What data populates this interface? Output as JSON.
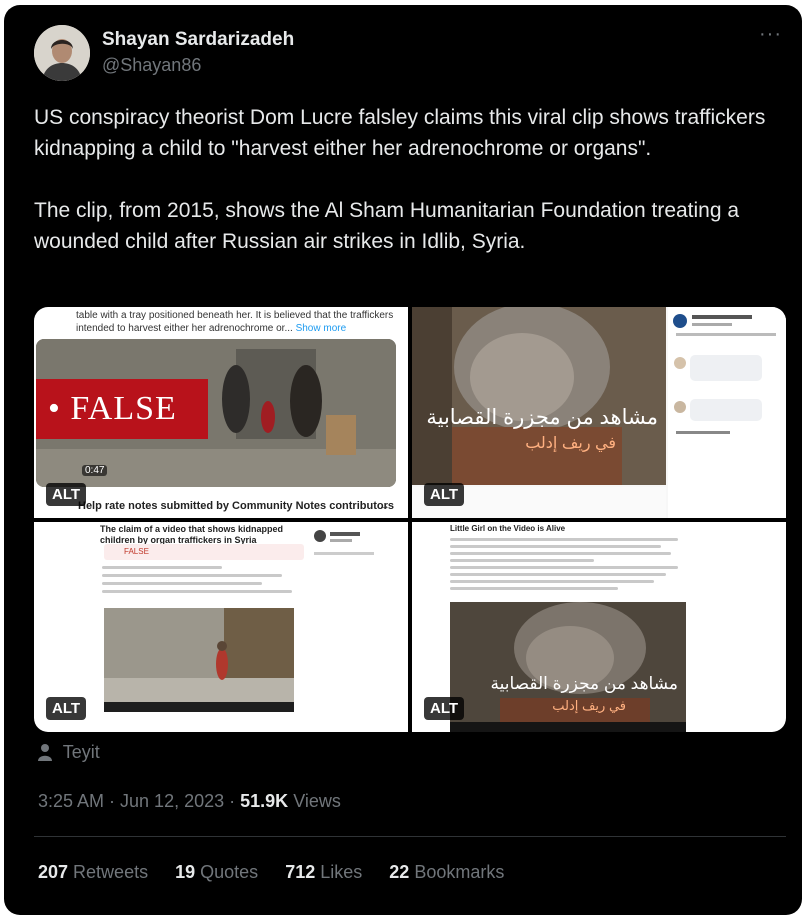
{
  "author": {
    "name": "Shayan Sardarizadeh",
    "handle": "@Shayan86"
  },
  "more_menu": "···",
  "tweet": {
    "paragraph1": "US conspiracy theorist Dom Lucre falsley claims this viral clip shows traffickers kidnapping a child to \"harvest either her adrenochrome or organs\".",
    "paragraph2": "The clip, from 2015, shows the Al Sham Humanitarian Foundation treating a wounded child after Russian air strikes in Idlib, Syria."
  },
  "media": {
    "alt_label": "ALT",
    "tile1": {
      "caption": "table with a tray positioned beneath her. It is believed that the traffickers intended to harvest either her adrenochrome or...",
      "show_more": "Show more",
      "false_label": "• FALSE",
      "duration": "0:47",
      "notes_text": "Help rate notes submitted by Community Notes contributors",
      "notes_arrow": "→"
    },
    "tile2": {
      "arabic_line1": "مشاهد من مجزرة القصابية",
      "arabic_line2": "في ريف إدلب"
    },
    "tile3": {
      "title": "The claim of a video that shows kidnapped children by organ traffickers in Syria",
      "false_badge": "FALSE"
    },
    "tile4": {
      "title": "Little Girl on the Video is Alive",
      "arabic_line1": "مشاهد من مجزرة القصابية",
      "arabic_line2": "في ريف إدلب"
    }
  },
  "location": "Teyit",
  "meta": {
    "time_date": "3:25 AM · Jun 12, 2023 · ",
    "views_count": "51.9K",
    "views_label": " Views"
  },
  "stats": {
    "retweets_num": "207",
    "retweets_label": " Retweets",
    "quotes_num": "19",
    "quotes_label": " Quotes",
    "likes_num": "712",
    "likes_label": " Likes",
    "bookmarks_num": "22",
    "bookmarks_label": " Bookmarks"
  },
  "colors": {
    "background": "#000000",
    "text": "#e7e9ea",
    "muted": "#71767b",
    "link": "#1d9bf0",
    "false_red": "#b8121b"
  }
}
